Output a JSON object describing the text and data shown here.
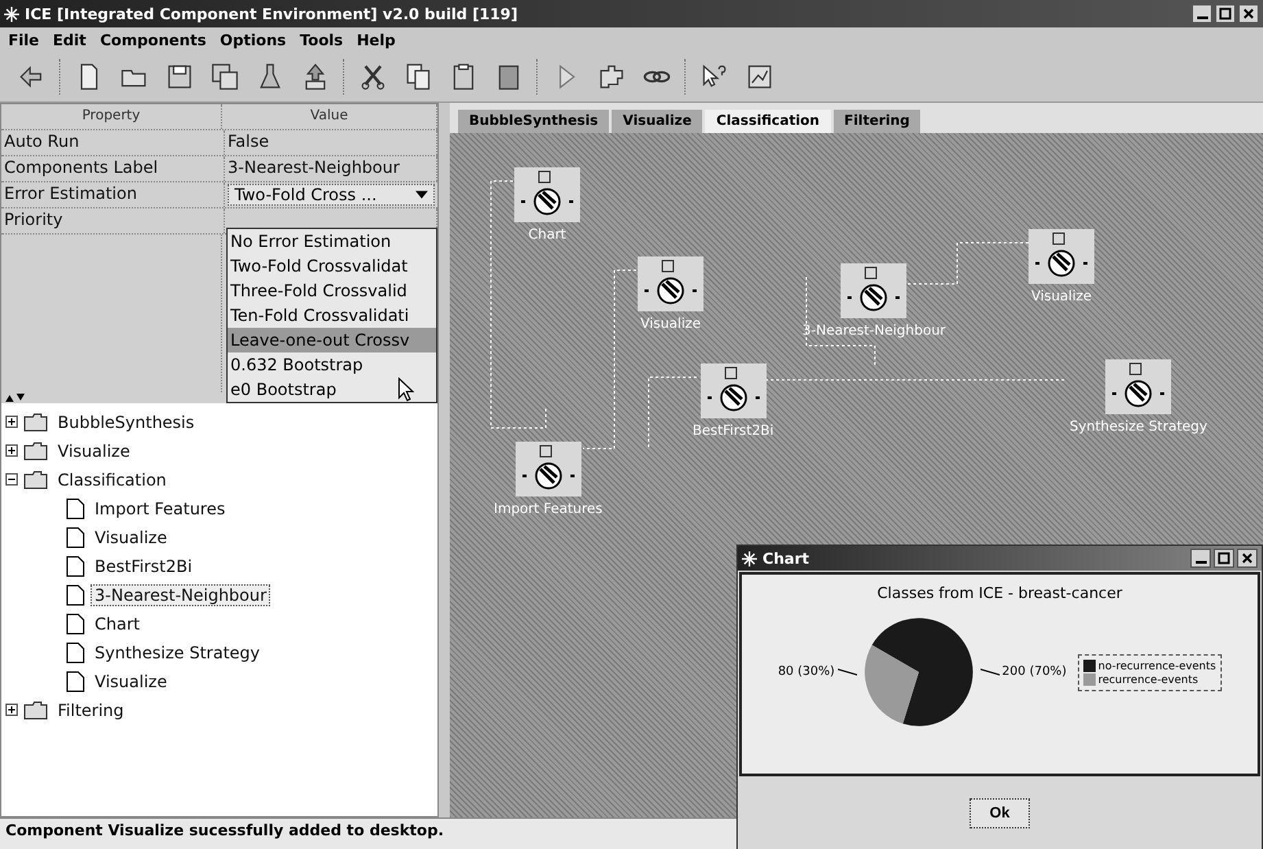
{
  "window": {
    "title": "ICE [Integrated Component Environment] v2.0 build [119]"
  },
  "menu": [
    "File",
    "Edit",
    "Components",
    "Options",
    "Tools",
    "Help"
  ],
  "properties": {
    "columns": [
      "Property",
      "Value"
    ],
    "rows": [
      {
        "name": "Auto Run",
        "value": "False",
        "kind": "text"
      },
      {
        "name": "Components Label",
        "value": "3-Nearest-Neighbour",
        "kind": "text"
      },
      {
        "name": "Error Estimation",
        "value": "Two-Fold Cross ...",
        "kind": "combo"
      },
      {
        "name": "Priority",
        "kind": "text"
      }
    ],
    "dropdown": [
      {
        "label": "No Error Estimation",
        "selected": false
      },
      {
        "label": "Two-Fold Crossvalidat",
        "selected": false
      },
      {
        "label": "Three-Fold Crossvalid",
        "selected": false
      },
      {
        "label": "Ten-Fold Crossvalidati",
        "selected": false
      },
      {
        "label": "Leave-one-out Crossv",
        "selected": true
      },
      {
        "label": "0.632 Bootstrap",
        "selected": false
      },
      {
        "label": "e0 Bootstrap",
        "selected": false
      }
    ]
  },
  "tree": [
    {
      "label": "BubbleSynthesis",
      "expanded": false,
      "selected": false
    },
    {
      "label": "Visualize",
      "expanded": false,
      "selected": false
    },
    {
      "label": "Classification",
      "expanded": true,
      "selected": false,
      "children": [
        {
          "label": "Import Features",
          "selected": false
        },
        {
          "label": "Visualize",
          "selected": false
        },
        {
          "label": "BestFirst2Bi",
          "selected": false
        },
        {
          "label": "3-Nearest-Neighbour",
          "selected": true
        },
        {
          "label": "Chart",
          "selected": false
        },
        {
          "label": "Synthesize Strategy",
          "selected": false
        },
        {
          "label": "Visualize",
          "selected": false
        }
      ]
    },
    {
      "label": "Filtering",
      "expanded": false,
      "selected": false
    }
  ],
  "tabs": [
    {
      "label": "BubbleSynthesis",
      "selected": false
    },
    {
      "label": "Visualize",
      "selected": false
    },
    {
      "label": "Classification",
      "selected": true
    },
    {
      "label": "Filtering",
      "selected": false
    }
  ],
  "canvas": {
    "nodes": [
      {
        "label": "Chart"
      },
      {
        "label": "Visualize"
      },
      {
        "label": "3-Nearest-Neighbour"
      },
      {
        "label": "Visualize"
      },
      {
        "label": "BestFirst2Bi"
      },
      {
        "label": "Synthesize Strategy"
      },
      {
        "label": "Import Features"
      }
    ]
  },
  "chart_window": {
    "title": "Chart",
    "button": "Ok",
    "chart_data": {
      "type": "pie",
      "title": "Classes from ICE - breast-cancer",
      "categories": [
        "no-recurrence-events",
        "recurrence-events"
      ],
      "values": [
        200,
        80
      ],
      "value_labels": [
        "200 (70%)",
        "80 (30%)"
      ],
      "colors": [
        "#1a1a1a",
        "#9a9a9a"
      ],
      "legend": "right"
    }
  },
  "status_bar": "Component Visualize sucessfully added to desktop."
}
